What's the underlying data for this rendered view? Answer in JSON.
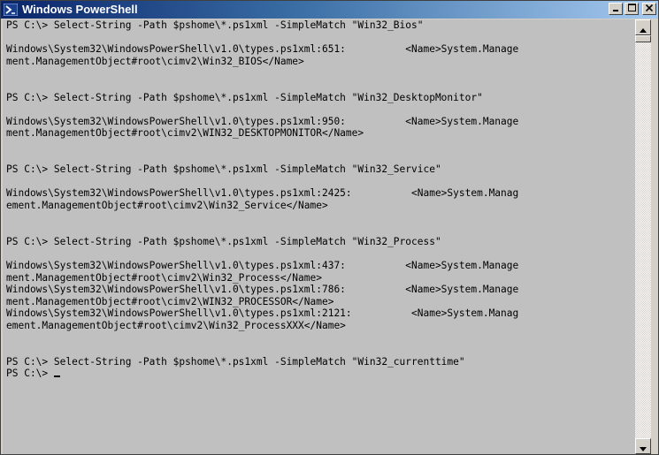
{
  "window": {
    "title": "Windows PowerShell",
    "app_icon": "powershell-icon",
    "minimize_icon": "minimize-icon",
    "maximize_icon": "maximize-icon",
    "close_icon": "close-icon"
  },
  "console": {
    "lines": [
      "PS C:\\> Select-String -Path $pshome\\*.ps1xml -SimpleMatch \"Win32_Bios\"",
      "",
      "Windows\\System32\\WindowsPowerShell\\v1.0\\types.ps1xml:651:          <Name>System.Manage",
      "ment.ManagementObject#root\\cimv2\\Win32_BIOS</Name>",
      "",
      "",
      "PS C:\\> Select-String -Path $pshome\\*.ps1xml -SimpleMatch \"Win32_DesktopMonitor\"",
      "",
      "Windows\\System32\\WindowsPowerShell\\v1.0\\types.ps1xml:950:          <Name>System.Manage",
      "ment.ManagementObject#root\\cimv2\\WIN32_DESKTOPMONITOR</Name>",
      "",
      "",
      "PS C:\\> Select-String -Path $pshome\\*.ps1xml -SimpleMatch \"Win32_Service\"",
      "",
      "Windows\\System32\\WindowsPowerShell\\v1.0\\types.ps1xml:2425:          <Name>System.Manag",
      "ement.ManagementObject#root\\cimv2\\Win32_Service</Name>",
      "",
      "",
      "PS C:\\> Select-String -Path $pshome\\*.ps1xml -SimpleMatch \"Win32_Process\"",
      "",
      "Windows\\System32\\WindowsPowerShell\\v1.0\\types.ps1xml:437:          <Name>System.Manage",
      "ment.ManagementObject#root\\cimv2\\Win32_Process</Name>",
      "Windows\\System32\\WindowsPowerShell\\v1.0\\types.ps1xml:786:          <Name>System.Manage",
      "ment.ManagementObject#root\\cimv2\\WIN32_PROCESSOR</Name>",
      "Windows\\System32\\WindowsPowerShell\\v1.0\\types.ps1xml:2121:          <Name>System.Manag",
      "ement.ManagementObject#root\\cimv2\\Win32_ProcessXXX</Name>",
      "",
      "",
      "PS C:\\> Select-String -Path $pshome\\*.ps1xml -SimpleMatch \"Win32_currenttime\"",
      "PS C:\\> "
    ]
  },
  "scrollbar": {
    "up_icon": "scroll-up-arrow-icon",
    "down_icon": "scroll-down-arrow-icon",
    "position": 0.0
  }
}
